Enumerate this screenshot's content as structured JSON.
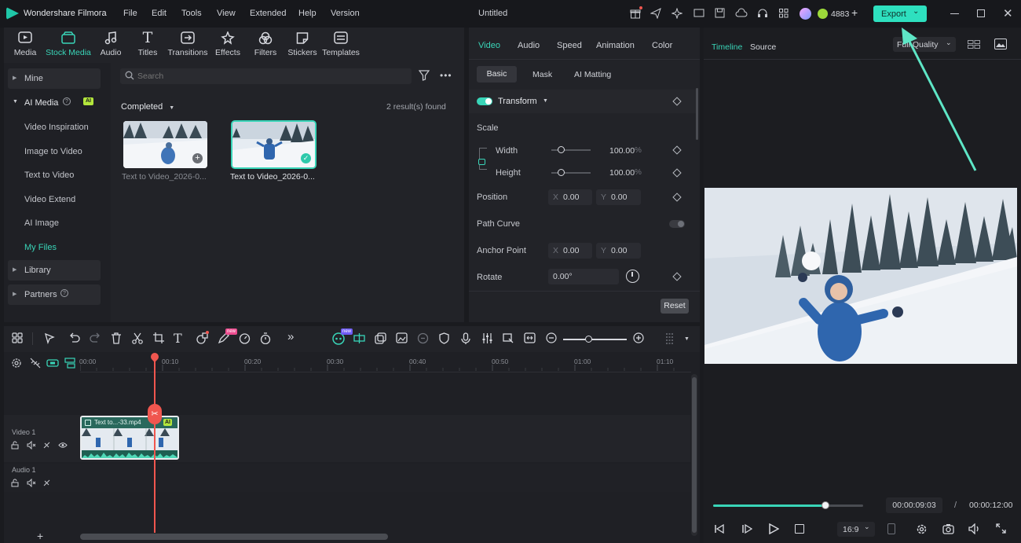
{
  "app": {
    "name": "Wondershare Filmora",
    "project_title": "Untitled",
    "credits": "4883",
    "export_label": "Export"
  },
  "menu": [
    "File",
    "Edit",
    "Tools",
    "View",
    "Extended",
    "Help",
    "Version"
  ],
  "tool_tabs": [
    "Media",
    "Stock Media",
    "Audio",
    "Titles",
    "Transitions",
    "Effects",
    "Filters",
    "Stickers",
    "Templates"
  ],
  "sidebar": {
    "mine": "Mine",
    "ai_media": "AI Media",
    "ai_badge": "AI",
    "sub_items": [
      "Video Inspiration",
      "Image to Video",
      "Text to Video",
      "Video Extend",
      "AI Image",
      "My Files"
    ],
    "library": "Library",
    "partners": "Partners"
  },
  "media": {
    "search_placeholder": "Search",
    "filter_label": "Completed",
    "results": "2 result(s) found",
    "clips": [
      "Text to Video_2026-0...",
      "Text to Video_2026-0..."
    ]
  },
  "properties": {
    "tabs": [
      "Video",
      "Audio",
      "Speed",
      "Animation",
      "Color"
    ],
    "subtabs": [
      "Basic",
      "Mask",
      "AI Matting"
    ],
    "transform": "Transform",
    "scale": "Scale",
    "width_label": "Width",
    "height_label": "Height",
    "width_value": "100.00",
    "height_value": "100.00",
    "percent": "%",
    "position": "Position",
    "pos_x": "0.00",
    "pos_y": "0.00",
    "path_curve": "Path Curve",
    "anchor_point": "Anchor Point",
    "anchor_x": "0.00",
    "anchor_y": "0.00",
    "rotate": "Rotate",
    "rotate_value": "0.00°",
    "x_prefix": "X",
    "y_prefix": "Y",
    "reset": "Reset"
  },
  "preview": {
    "tabs": [
      "Timeline",
      "Source"
    ],
    "quality": "Full Quality",
    "current_time": "00:00:09:03",
    "separator": "/",
    "total_time": "00:00:12:00",
    "aspect": "16:9",
    "progress": 0.75
  },
  "timeline": {
    "ruler": [
      "00:00",
      "00:10",
      "00:20",
      "00:30",
      "00:40",
      "00:50",
      "01:00",
      "01:10"
    ],
    "video_track": "Video 1",
    "audio_track": "Audio 1",
    "clip_label": "Text to...-33.mp4",
    "clip_ai": "AI",
    "new_badge": "new"
  },
  "colors": {
    "accent": "#39d5b8",
    "playhead": "#f0564f",
    "export_bg": "#2ee0bf"
  }
}
